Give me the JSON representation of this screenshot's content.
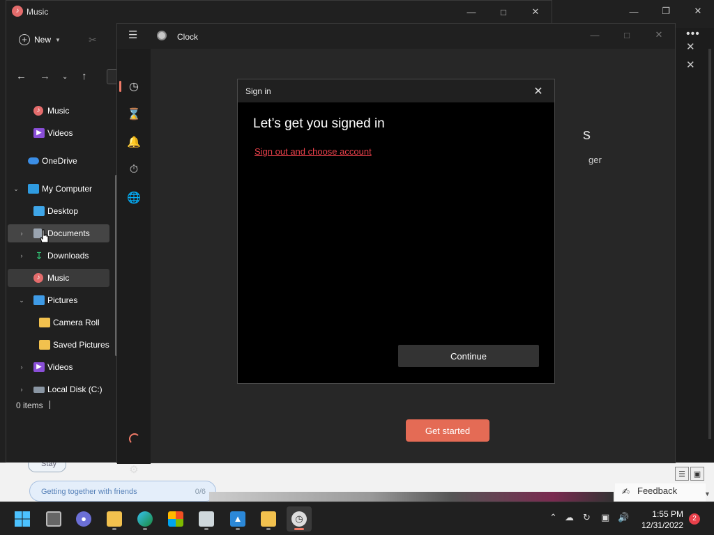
{
  "explorer": {
    "title": "Music",
    "toolbar": {
      "new_label": "New"
    },
    "sidebar": {
      "items": [
        {
          "label": "Music"
        },
        {
          "label": "Videos"
        },
        {
          "label": "OneDrive"
        },
        {
          "label": "My Computer"
        },
        {
          "label": "Desktop"
        },
        {
          "label": "Documents"
        },
        {
          "label": "Downloads"
        },
        {
          "label": "Music"
        },
        {
          "label": "Pictures"
        },
        {
          "label": "Camera Roll"
        },
        {
          "label": "Saved Pictures"
        },
        {
          "label": "Videos"
        },
        {
          "label": "Local Disk (C:)"
        }
      ]
    },
    "status": "0 items"
  },
  "clock": {
    "title": "Clock",
    "get_started_label": "Get started",
    "background_partial_text_1": "s",
    "background_partial_text_2": "ger"
  },
  "signin": {
    "title": "Sign in",
    "heading": "Let’s get you signed in",
    "link": "Sign out and choose account",
    "continue_label": "Continue"
  },
  "background": {
    "pill_a": "Stay",
    "pill_b": "Getting together with friends",
    "pill_b_count": "0/6",
    "feedback": "Feedback"
  },
  "taskbar": {
    "time": "1:55 PM",
    "date": "12/31/2022",
    "notification_count": "2"
  },
  "colors": {
    "accent": "#ef7a67",
    "link": "#e8404a",
    "get_started": "#e46b55"
  }
}
